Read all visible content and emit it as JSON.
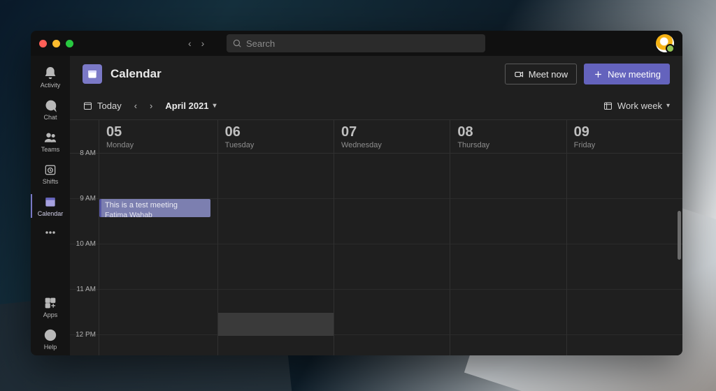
{
  "search": {
    "placeholder": "Search"
  },
  "sidebar": {
    "items": [
      {
        "label": "Activity"
      },
      {
        "label": "Chat"
      },
      {
        "label": "Teams"
      },
      {
        "label": "Shifts"
      },
      {
        "label": "Calendar"
      },
      {
        "label": "Apps"
      },
      {
        "label": "Help"
      }
    ]
  },
  "page": {
    "title": "Calendar",
    "meet_now": "Meet now",
    "new_meeting": "New meeting"
  },
  "toolbar": {
    "today": "Today",
    "month": "April 2021",
    "view": "Work week"
  },
  "days": [
    {
      "num": "05",
      "name": "Monday"
    },
    {
      "num": "06",
      "name": "Tuesday"
    },
    {
      "num": "07",
      "name": "Wednesday"
    },
    {
      "num": "08",
      "name": "Thursday"
    },
    {
      "num": "09",
      "name": "Friday"
    }
  ],
  "hours": [
    "8 AM",
    "9 AM",
    "10 AM",
    "11 AM",
    "12 PM"
  ],
  "event": {
    "title": "This is a test meeting",
    "organizer": "Fatima Wahab",
    "day_index": 0,
    "start_hour_index": 1,
    "duration_slots": 0.4
  },
  "highlight": {
    "day_index": 1,
    "hour_index": 3,
    "half": "bottom"
  }
}
